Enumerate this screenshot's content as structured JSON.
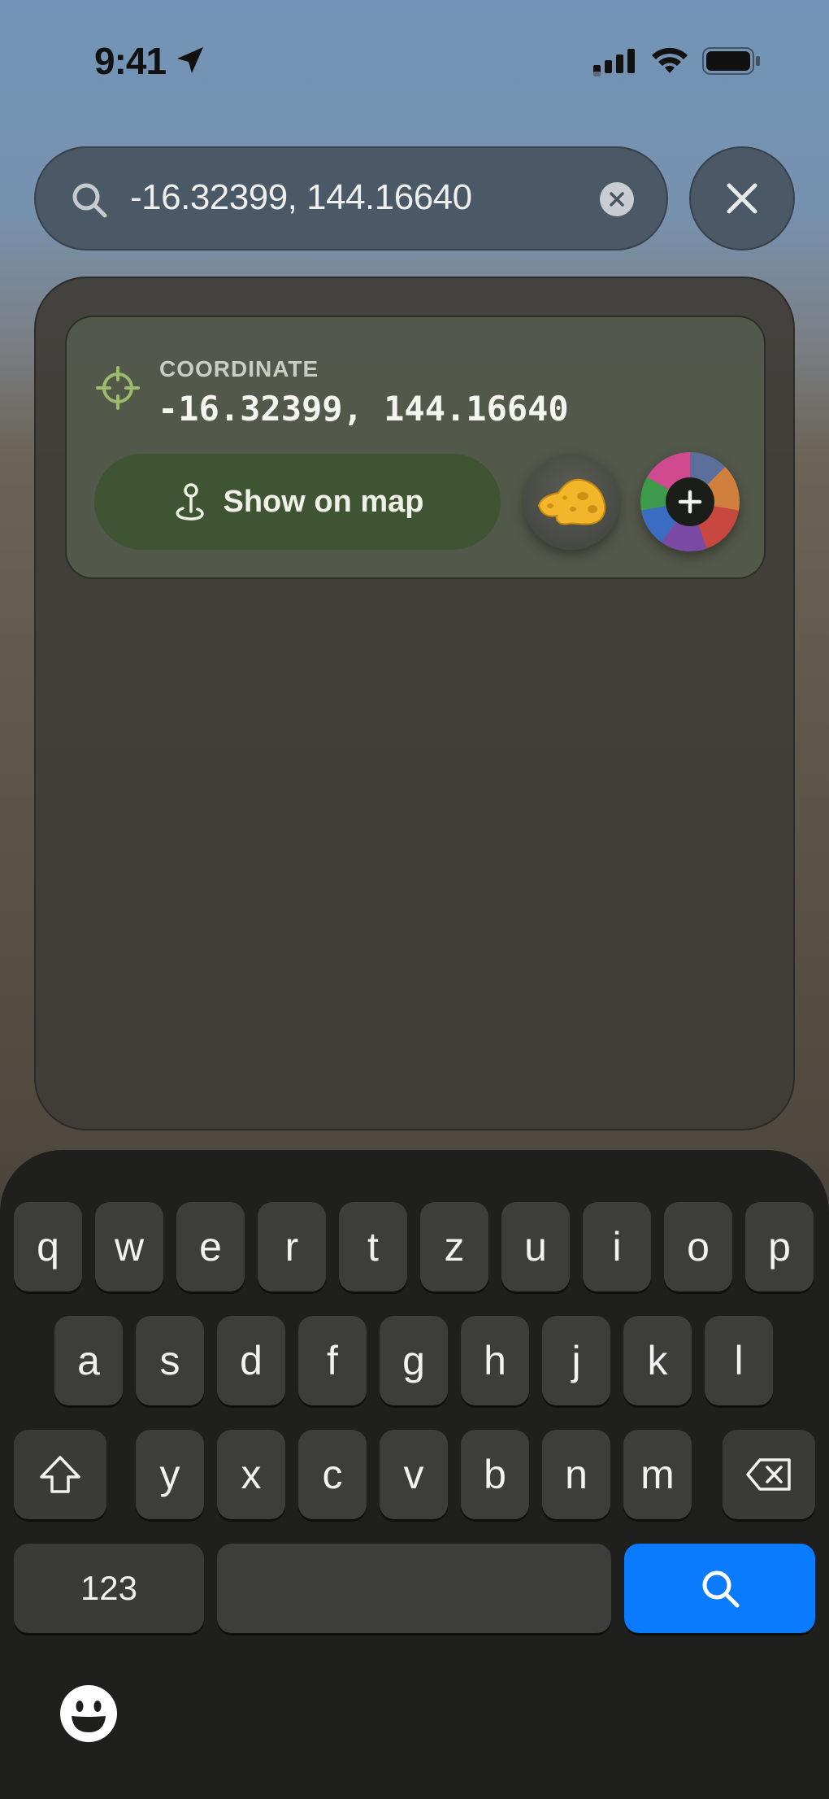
{
  "status_bar": {
    "time": "9:41",
    "icons": [
      "location-arrow-icon",
      "cellular-signal-icon",
      "wifi-icon",
      "battery-icon"
    ]
  },
  "search": {
    "value": "-16.32399, 144.16640",
    "icon": "search-icon",
    "clear_icon": "clear-icon",
    "close_icon": "close-icon"
  },
  "result": {
    "label": "COORDINATE",
    "value": "-16.32399, 144.16640",
    "icon": "crosshair-icon",
    "show_map_label": "Show on map",
    "show_map_icon": "map-pin-icon",
    "cheese_icon": "cheese-icon",
    "add_icon": "plus-icon",
    "accent_color": "#3f5432"
  },
  "keyboard": {
    "row1": [
      "q",
      "w",
      "e",
      "r",
      "t",
      "z",
      "u",
      "i",
      "o",
      "p"
    ],
    "row2": [
      "a",
      "s",
      "d",
      "f",
      "g",
      "h",
      "j",
      "k",
      "l"
    ],
    "row3": [
      "y",
      "x",
      "c",
      "v",
      "b",
      "n",
      "m"
    ],
    "numbers_label": "123",
    "shift_icon": "shift-icon",
    "backspace_icon": "backspace-icon",
    "search_key_icon": "search-icon",
    "emoji_icon": "emoji-icon",
    "search_key_color": "#0a7aff"
  }
}
